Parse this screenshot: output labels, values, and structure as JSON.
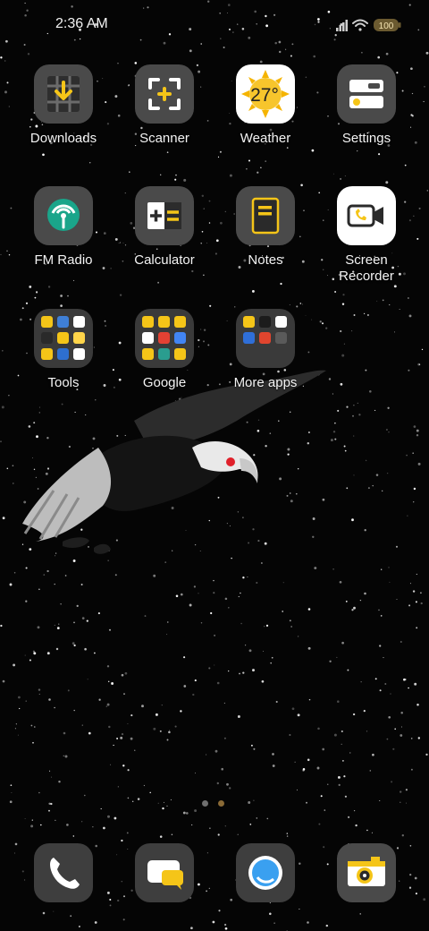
{
  "status": {
    "time": "2:36 AM",
    "battery": "100"
  },
  "apps": [
    {
      "label": "Downloads",
      "icon": "download-icon"
    },
    {
      "label": "Scanner",
      "icon": "scanner-icon"
    },
    {
      "label": "Weather",
      "icon": "weather-sun-icon",
      "temperature": "27°"
    },
    {
      "label": "Settings",
      "icon": "settings-toggle-icon"
    },
    {
      "label": "FM Radio",
      "icon": "radio-icon"
    },
    {
      "label": "Calculator",
      "icon": "calculator-icon"
    },
    {
      "label": "Notes",
      "icon": "notes-icon"
    },
    {
      "label": "Screen Recorder",
      "icon": "video-call-icon"
    },
    {
      "label": "Tools",
      "icon": "folder-icon"
    },
    {
      "label": "Google",
      "icon": "folder-icon"
    },
    {
      "label": "More apps",
      "icon": "folder-icon"
    }
  ],
  "dock": [
    {
      "icon": "phone-icon"
    },
    {
      "icon": "messages-icon"
    },
    {
      "icon": "browser-icon"
    },
    {
      "icon": "camera-icon"
    }
  ],
  "pages": {
    "count": 2,
    "current": 1
  },
  "colors": {
    "accent": "#f5c518",
    "tile": "#4a4a4a",
    "background": "#050505"
  }
}
